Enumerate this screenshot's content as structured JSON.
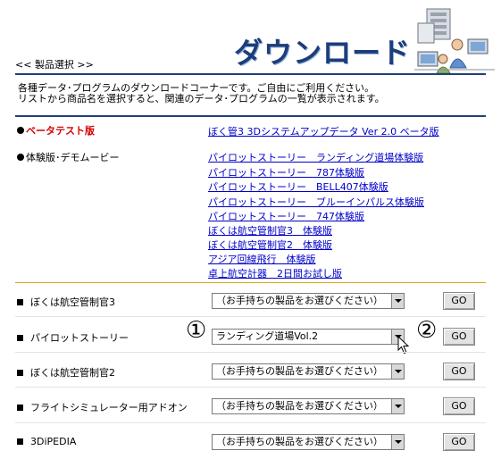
{
  "header": {
    "breadcrumb": "<< 製品選択 >>",
    "title": "ダウンロード"
  },
  "intro": {
    "line1": "各種データ･プログラムのダウンロードコーナーです。ご自由にご利用ください。",
    "line2": "リストから商品名を選択すると、関連のデータ･プログラムの一覧が表示されます。"
  },
  "sections": {
    "beta": {
      "label": "ベータテスト版",
      "links": [
        "ぼく管3 3Dシステムアップデータ Ver 2.0 ベータ版"
      ]
    },
    "trial": {
      "label": "体験版･デモムービー",
      "links": [
        "パイロットストーリー　ランディング道場体験版",
        "パイロットストーリー　787体験版",
        "パイロットストーリー　BELL407体験版",
        "パイロットストーリー　ブルーインパルス体験版",
        "パイロットストーリー　747体験版",
        "ぼくは航空管制官3　体験版",
        "ぼくは航空管制官2　体験版",
        "アジア回線飛行　体験版",
        "卓上航空計器　2日間お試し版"
      ]
    }
  },
  "products": [
    {
      "label": "ぼくは航空管制官3",
      "selected": "（お手持ちの製品をお選びください）",
      "go": "GO"
    },
    {
      "label": "パイロットストーリー",
      "selected": "ランディング道場Vol.2",
      "go": "GO"
    },
    {
      "label": "ぼくは航空管制官2",
      "selected": "（お手持ちの製品をお選びください）",
      "go": "GO"
    },
    {
      "label": "フライトシミュレーター用アドオン",
      "selected": "（お手持ちの製品をお選びください）",
      "go": "GO"
    },
    {
      "label": "3DiPEDIA",
      "selected": "（お手持ちの製品をお選びください）",
      "go": "GO"
    }
  ],
  "markers": {
    "one": "①",
    "two": "②"
  },
  "colors": {
    "accent": "#1f3f7a",
    "beta_label": "#d40000",
    "link": "#0000cc",
    "divider_gold": "#d9a520"
  }
}
